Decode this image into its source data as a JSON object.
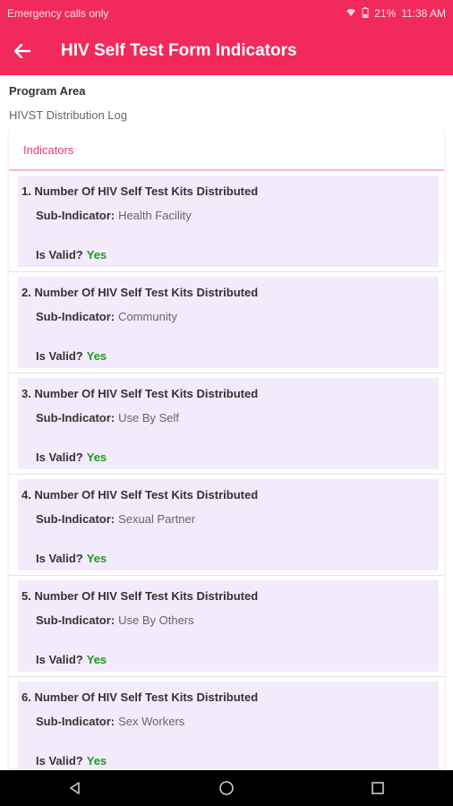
{
  "status_bar": {
    "carrier": "Emergency calls only",
    "battery": "21%",
    "time": "11:38 AM"
  },
  "app_bar": {
    "title": "HIV Self Test Form Indicators"
  },
  "program": {
    "label": "Program Area",
    "value": "HIVST Distribution Log"
  },
  "indicators": {
    "header": "Indicators",
    "sub_indicator_label": "Sub-Indicator:",
    "is_valid_label": "Is Valid?",
    "items": [
      {
        "title": "1. Number Of HIV Self Test Kits Distributed",
        "sub": "Health Facility",
        "valid": "Yes"
      },
      {
        "title": "2. Number Of HIV Self Test Kits Distributed",
        "sub": "Community",
        "valid": "Yes"
      },
      {
        "title": "3. Number Of HIV Self Test Kits Distributed",
        "sub": "Use By Self",
        "valid": "Yes"
      },
      {
        "title": "4. Number Of HIV Self Test Kits Distributed",
        "sub": "Sexual Partner",
        "valid": "Yes"
      },
      {
        "title": "5. Number Of HIV Self Test Kits Distributed",
        "sub": "Use By Others",
        "valid": "Yes"
      },
      {
        "title": "6. Number Of HIV Self Test Kits Distributed",
        "sub": "Sex Workers",
        "valid": "Yes"
      }
    ]
  },
  "colors": {
    "primary": "#f2295b",
    "card_bg": "#f3eafc",
    "valid": "#1a9e1a"
  }
}
